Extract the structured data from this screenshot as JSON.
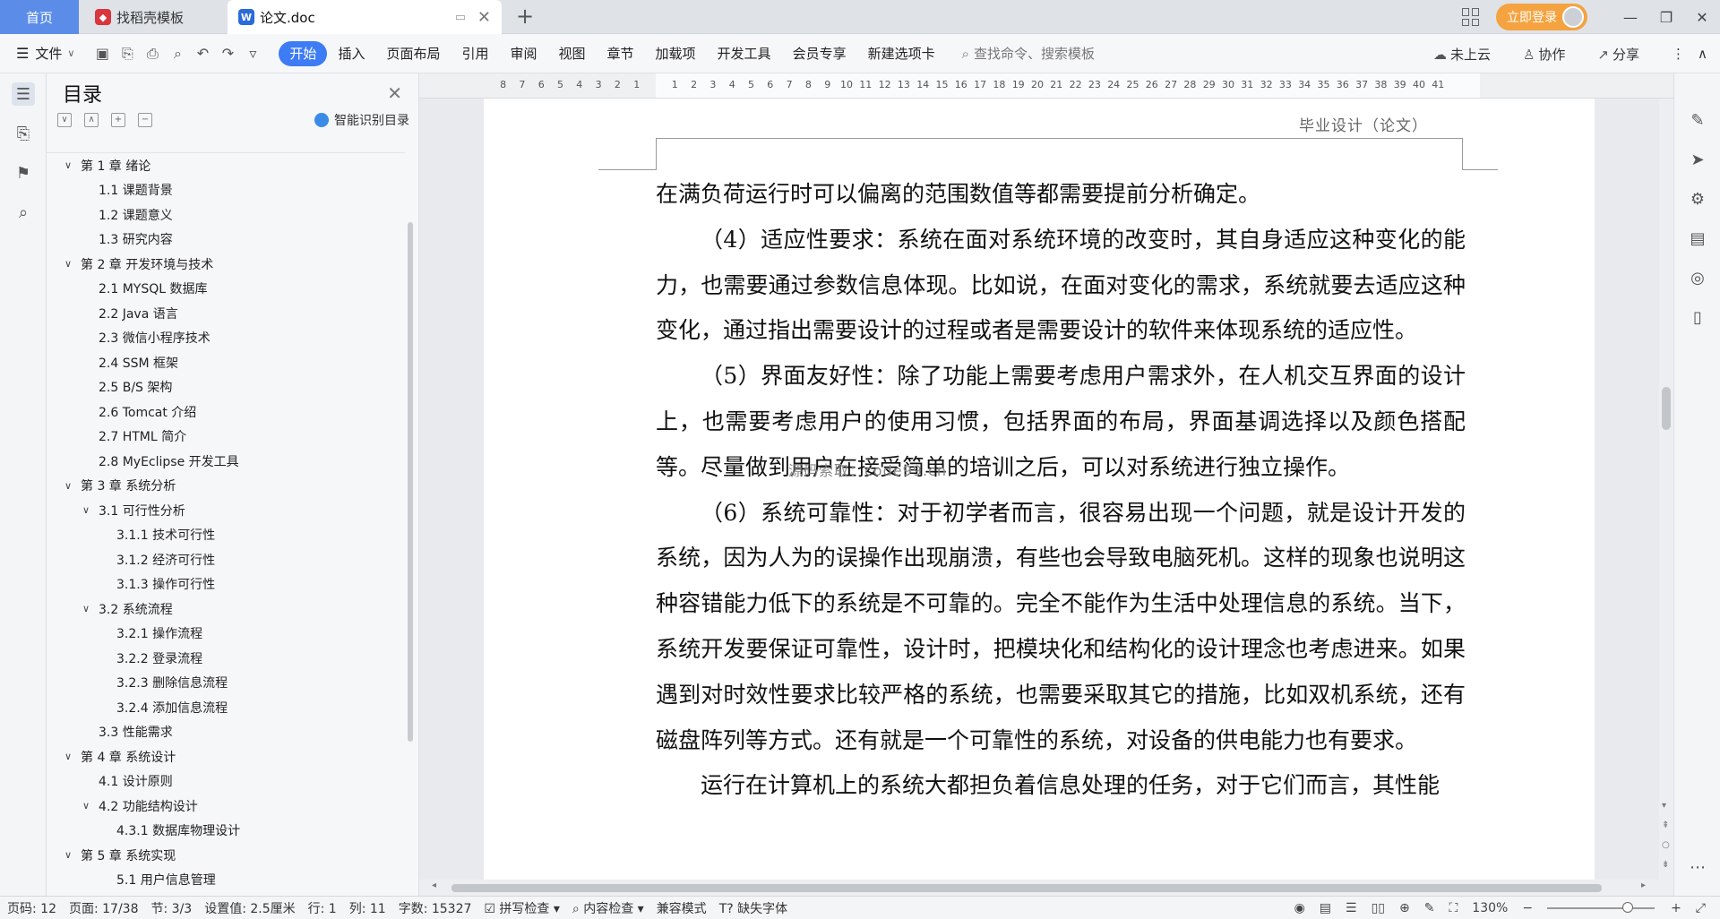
{
  "titlebar": {
    "home_tab": "首页",
    "template_tab": "找稻壳模板",
    "doc_tab": "论文.doc",
    "login_label": "立即登录"
  },
  "ribbon": {
    "file_label": "文件",
    "tabs": [
      "开始",
      "插入",
      "页面布局",
      "引用",
      "审阅",
      "视图",
      "章节",
      "加载项",
      "开发工具",
      "会员专享",
      "新建选项卡"
    ],
    "search_placeholder": "查找命令、搜索模板",
    "cloud_label": "未上云",
    "collab_label": "协作",
    "share_label": "分享"
  },
  "toc": {
    "title": "目录",
    "smart_label": "智能识别目录",
    "items": [
      {
        "text": "第 1 章  绪论",
        "level": "l1",
        "arrow": true
      },
      {
        "text": "1.1  课题背景",
        "level": "l2"
      },
      {
        "text": "1.2  课题意义",
        "level": "l2"
      },
      {
        "text": "1.3  研究内容",
        "level": "l2"
      },
      {
        "text": "第 2 章  开发环境与技术",
        "level": "l1",
        "arrow": true
      },
      {
        "text": "2.1  MYSQL 数据库",
        "level": "l2"
      },
      {
        "text": "2.2  Java 语言",
        "level": "l2"
      },
      {
        "text": "2.3  微信小程序技术",
        "level": "l2"
      },
      {
        "text": "2.4  SSM 框架",
        "level": "l2"
      },
      {
        "text": "2.5  B/S 架构",
        "level": "l2"
      },
      {
        "text": "2.6  Tomcat  介绍",
        "level": "l2"
      },
      {
        "text": "2.7  HTML 简介",
        "level": "l2"
      },
      {
        "text": "2.8  MyEclipse 开发工具",
        "level": "l2"
      },
      {
        "text": "第 3 章  系统分析",
        "level": "l1",
        "arrow": true
      },
      {
        "text": "3.1  可行性分析",
        "level": "l2a",
        "arrow": true
      },
      {
        "text": "3.1.1  技术可行性",
        "level": "l3"
      },
      {
        "text": "3.1.2  经济可行性",
        "level": "l3"
      },
      {
        "text": "3.1.3  操作可行性",
        "level": "l3"
      },
      {
        "text": "3.2  系统流程",
        "level": "l2a",
        "arrow": true
      },
      {
        "text": "3.2.1  操作流程",
        "level": "l3"
      },
      {
        "text": "3.2.2  登录流程",
        "level": "l3"
      },
      {
        "text": "3.2.3  删除信息流程",
        "level": "l3"
      },
      {
        "text": "3.2.4  添加信息流程",
        "level": "l3"
      },
      {
        "text": "3.3  性能需求",
        "level": "l2"
      },
      {
        "text": "第 4 章  系统设计",
        "level": "l1",
        "arrow": true
      },
      {
        "text": "4.1  设计原则",
        "level": "l2"
      },
      {
        "text": "4.2  功能结构设计",
        "level": "l2a",
        "arrow": true
      },
      {
        "text": "4.3.1  数据库物理设计",
        "level": "l3"
      },
      {
        "text": "第 5 章  系统实现",
        "level": "l1",
        "arrow": true
      },
      {
        "text": "5.1 用户信息管理",
        "level": "l3"
      }
    ]
  },
  "ruler": {
    "left_numbers": [
      "8",
      "7",
      "6",
      "5",
      "4",
      "3",
      "2",
      "1"
    ],
    "right_numbers": [
      "1",
      "2",
      "3",
      "4",
      "5",
      "6",
      "7",
      "8",
      "9",
      "10",
      "11",
      "12",
      "13",
      "14",
      "15",
      "16",
      "17",
      "18",
      "19",
      "20",
      "21",
      "22",
      "23",
      "24",
      "25",
      "26",
      "27",
      "28",
      "29",
      "30",
      "31",
      "32",
      "33",
      "34",
      "35",
      "36",
      "37",
      "38",
      "39",
      "40",
      "41"
    ]
  },
  "document": {
    "header": "毕业设计（论文）",
    "paragraphs": [
      {
        "text": "在满负荷运行时可以偏离的范围数值等都需要提前分析确定。",
        "indent": false
      },
      {
        "text": "（4）适应性要求：系统在面对系统环境的改变时，其自身适应这种变化的能力，也需要通过参数信息体现。比如说，在面对变化的需求，系统就要去适应这种变化，通过指出需要设计的过程或者是需要设计的软件来体现系统的适应性。",
        "indent": true
      },
      {
        "text": "（5）界面友好性：除了功能上需要考虑用户需求外，在人机交互界面的设计上，也需要考虑用户的使用习惯，包括界面的布局，界面基调选择以及颜色搭配等。尽量做到用户在接受简单的培训之后，可以对系统进行独立操作。",
        "indent": true
      },
      {
        "text": "（6）系统可靠性：对于初学者而言，很容易出现一个问题，就是设计开发的系统，因为人为的误操作出现崩溃，有些也会导致电脑死机。这样的现象也说明这种容错能力低下的系统是不可靠的。完全不能作为生活中处理信息的系统。当下，系统开发要保证可靠性，设计时，把模块化和结构化的设计理念也考虑进来。如果遇到对时效性要求比较严格的系统，也需要采取其它的措施，比如双机系统，还有磁盘阵列等方式。还有就是一个可靠性的系统，对设备的供电能力也有要求。",
        "indent": true
      },
      {
        "text": "运行在计算机上的系统大都担负着信息处理的任务，对于它们而言，其性能",
        "indent": true
      }
    ],
    "watermark": "源码索取：code99.cn"
  },
  "status": {
    "page_no": "页码: 12",
    "page": "页面: 17/38",
    "section": "节: 3/3",
    "setting": "设置值: 2.5厘米",
    "row": "行: 1",
    "col": "列: 11",
    "words": "字数: 15327",
    "spell": "拼写检查",
    "content_check": "内容检查",
    "compat": "兼容模式",
    "missing_font": "缺失字体",
    "zoom": "130%"
  }
}
